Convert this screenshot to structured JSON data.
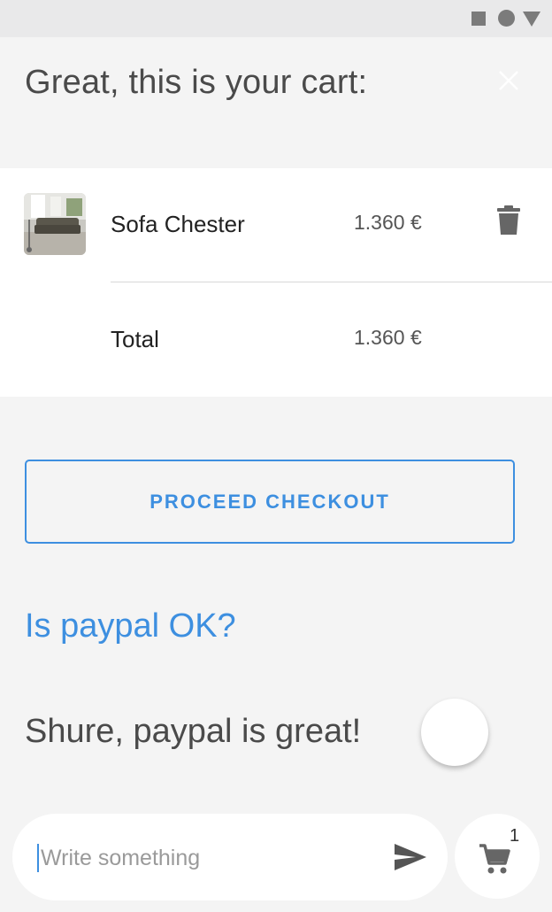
{
  "header": {
    "title": "Great, this is your cart:"
  },
  "cart": {
    "items": [
      {
        "name": "Sofa Chester",
        "price": "1.360 €"
      }
    ],
    "total_label": "Total",
    "total_price": "1.360 €"
  },
  "checkout": {
    "label": "PROCEED CHECKOUT"
  },
  "messages": {
    "bot": "Is paypal OK?",
    "user": "Shure, paypal is great!"
  },
  "composer": {
    "placeholder": "Write something"
  },
  "cart_fab": {
    "count": "1"
  },
  "colors": {
    "accent": "#3d8fe0",
    "background": "#f4f4f4",
    "card": "#ffffff"
  }
}
